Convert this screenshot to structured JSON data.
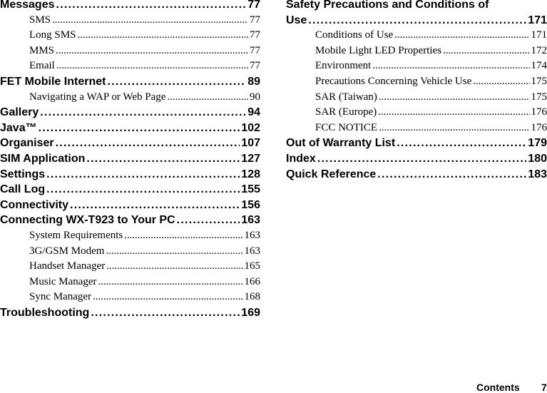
{
  "left_column": [
    {
      "level": "main",
      "title": "Messages",
      "page": "77"
    },
    {
      "level": "sub",
      "title": "SMS",
      "page": "77"
    },
    {
      "level": "sub",
      "title": "Long SMS",
      "page": "77"
    },
    {
      "level": "sub",
      "title": "MMS",
      "page": "77"
    },
    {
      "level": "sub",
      "title": "Email",
      "page": "77"
    },
    {
      "level": "main",
      "title": "FET Mobile Internet",
      "page": "89"
    },
    {
      "level": "sub",
      "title": "Navigating a WAP or Web Page",
      "page": "90"
    },
    {
      "level": "main",
      "title": "Gallery",
      "page": "94"
    },
    {
      "level": "main",
      "title": "Java™",
      "page": "102"
    },
    {
      "level": "main",
      "title": "Organiser",
      "page": "107"
    },
    {
      "level": "main",
      "title": "SIM Application",
      "page": "127"
    },
    {
      "level": "main",
      "title": "Settings",
      "page": "128"
    },
    {
      "level": "main",
      "title": "Call Log",
      "page": "155"
    },
    {
      "level": "main",
      "title": "Connectivity",
      "page": "156"
    },
    {
      "level": "main",
      "title": "Connecting WX-T923 to Your PC",
      "page": "163"
    },
    {
      "level": "sub",
      "title": "System Requirements",
      "page": "163"
    },
    {
      "level": "sub",
      "title": "3G/GSM Modem",
      "page": "163"
    },
    {
      "level": "sub",
      "title": "Handset Manager",
      "page": "165"
    },
    {
      "level": "sub",
      "title": "Music Manager",
      "page": "166"
    },
    {
      "level": "sub",
      "title": "Sync Manager",
      "page": "168"
    },
    {
      "level": "main",
      "title": "Troubleshooting",
      "page": "169"
    }
  ],
  "right_column": [
    {
      "level": "main-nopage",
      "title": "Safety Precautions and Conditions of",
      "page": ""
    },
    {
      "level": "main",
      "title": "Use",
      "page": "171"
    },
    {
      "level": "sub",
      "title": "Conditions of Use",
      "page": "171"
    },
    {
      "level": "sub",
      "title": "Mobile Light LED Properties",
      "page": "172"
    },
    {
      "level": "sub",
      "title": "Environment",
      "page": "174"
    },
    {
      "level": "sub",
      "title": "Precautions Concerning Vehicle Use",
      "page": "175"
    },
    {
      "level": "sub",
      "title": "SAR (Taiwan)",
      "page": "175"
    },
    {
      "level": "sub",
      "title": "SAR (Europe)",
      "page": "176"
    },
    {
      "level": "sub",
      "title": "FCC NOTICE",
      "page": "176"
    },
    {
      "level": "main",
      "title": "Out of Warranty List",
      "page": "179"
    },
    {
      "level": "main",
      "title": "Index",
      "page": "180"
    },
    {
      "level": "main",
      "title": "Quick Reference",
      "page": "183"
    }
  ],
  "footer": {
    "section": "Contents",
    "page_number": "7"
  }
}
